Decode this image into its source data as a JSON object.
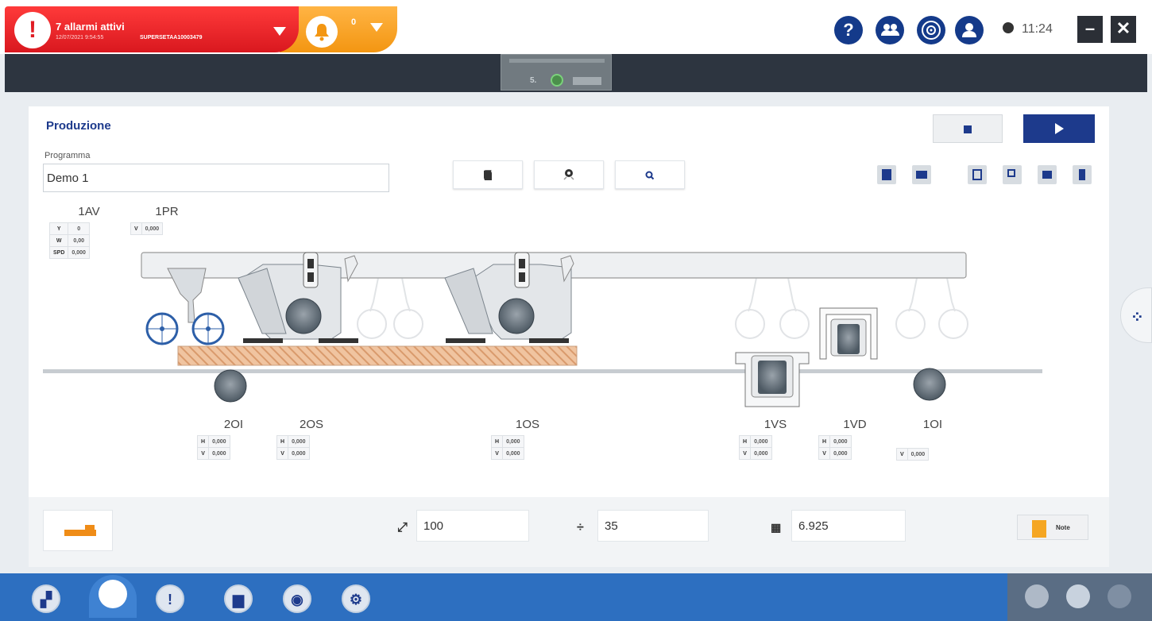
{
  "alarm": {
    "title": "7 allarmi attivi",
    "date": "12/07/2021 9:54:55",
    "code": "SUPERSETAA10003479",
    "icon": "exclamation-icon"
  },
  "notifications": {
    "count": "0",
    "icon": "bell-icon"
  },
  "toolbar": {
    "icons": [
      "help-icon",
      "users-icon",
      "disc-icon",
      "user-icon"
    ],
    "time": "11:24",
    "minimize": "–",
    "close": "✕"
  },
  "machine_badge": {
    "number": "5."
  },
  "production": {
    "title": "Produzione",
    "program_label": "Programma",
    "program_value": "Demo 1",
    "note_label": "Note"
  },
  "axes": {
    "top": [
      {
        "name": "1AV",
        "rows": [
          [
            "Y",
            "0"
          ],
          [
            "W",
            "0,00"
          ],
          [
            "SPD",
            "0,000"
          ]
        ]
      },
      {
        "name": "1PR",
        "rows": [
          [
            "V",
            "0,000"
          ]
        ]
      }
    ],
    "bottom": [
      {
        "name": "2OI",
        "rows": [
          [
            "H",
            "0,000"
          ],
          [
            "V",
            "0,000"
          ]
        ]
      },
      {
        "name": "2OS",
        "rows": [
          [
            "H",
            "0,000"
          ],
          [
            "V",
            "0,000"
          ]
        ]
      },
      {
        "name": "1OS",
        "rows": [
          [
            "H",
            "0,000"
          ],
          [
            "V",
            "0,000"
          ]
        ]
      },
      {
        "name": "1VS",
        "rows": [
          [
            "H",
            "0,000"
          ],
          [
            "V",
            "0,000"
          ]
        ]
      },
      {
        "name": "1VD",
        "rows": [
          [
            "H",
            "0,000"
          ],
          [
            "V",
            "0,000"
          ]
        ]
      },
      {
        "name": "1OI",
        "rows": [
          [
            "V",
            "0,000"
          ]
        ]
      }
    ]
  },
  "fields": {
    "size": "100",
    "divide": "35",
    "counter": "6.925"
  },
  "colors": {
    "alarm": "#e01c24",
    "notification": "#f39612",
    "primary": "#1d3a8c",
    "nav": "#2d6fc0",
    "wood": "#e8b48f"
  }
}
